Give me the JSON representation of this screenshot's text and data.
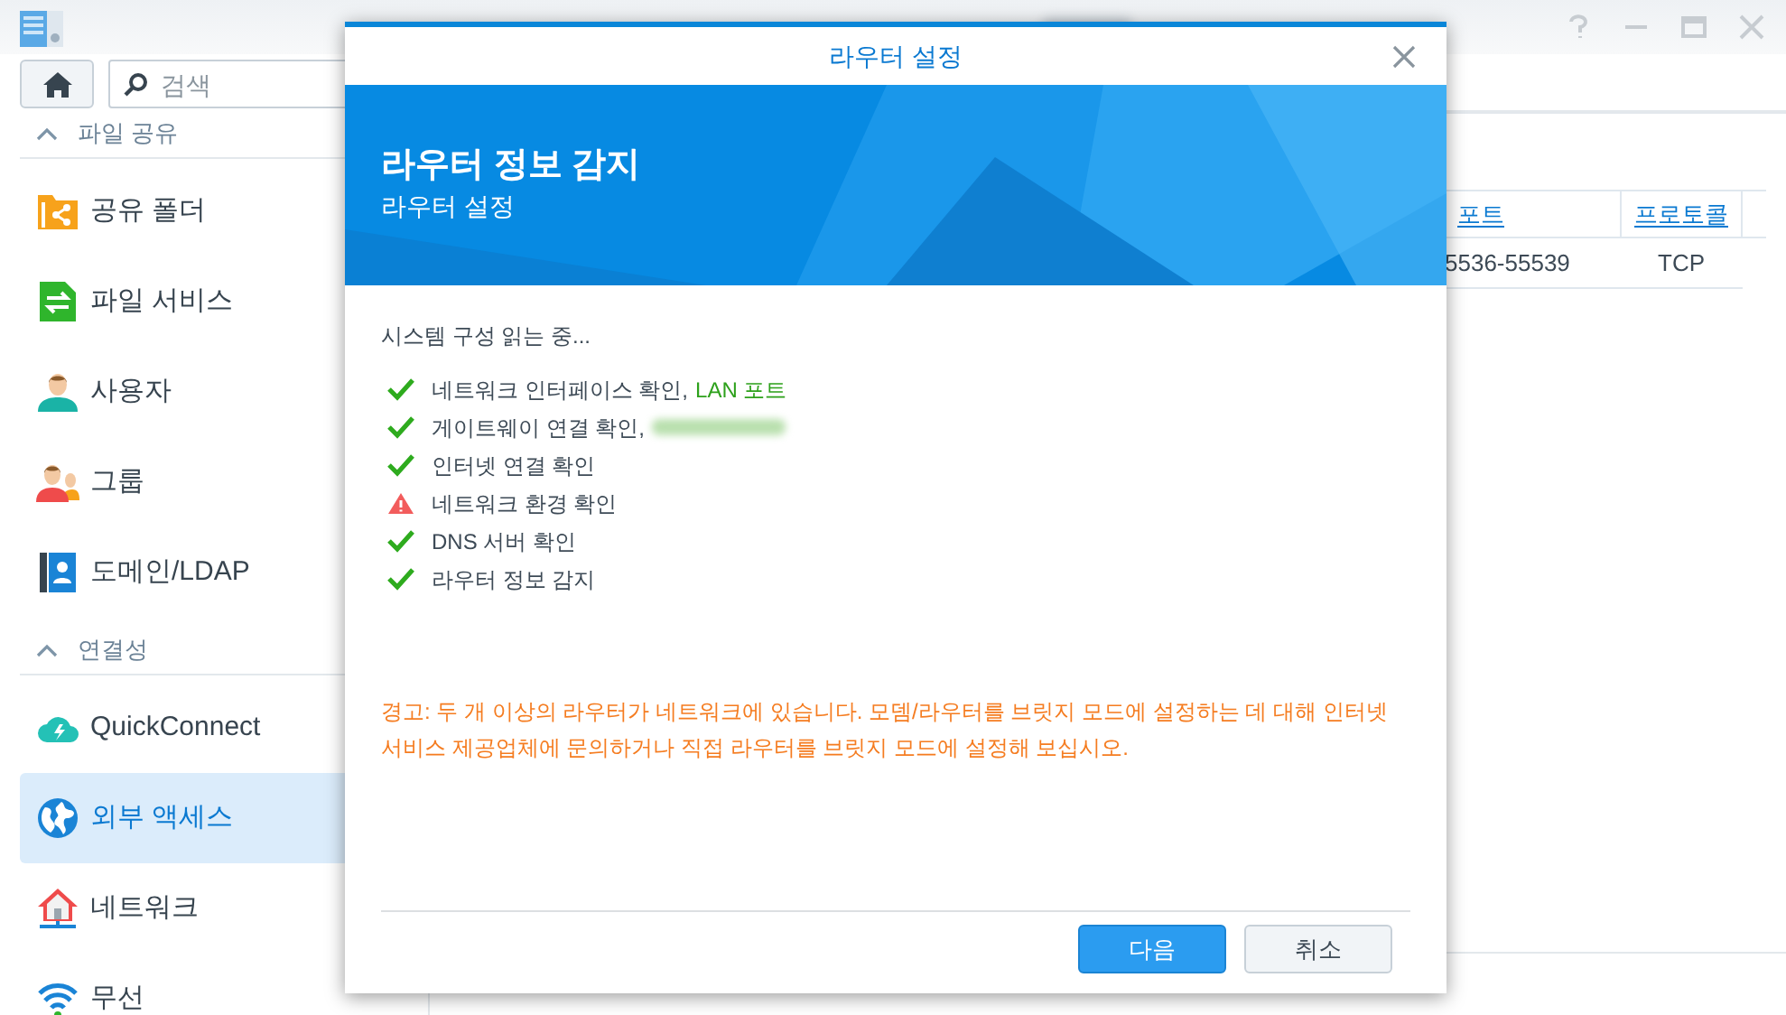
{
  "window": {
    "title_blurred": true
  },
  "toolbar": {
    "search": {
      "placeholder": "검색"
    }
  },
  "sidebar": {
    "sections": [
      {
        "title": "파일 공유",
        "expanded": true,
        "items": [
          {
            "label": "공유 폴더",
            "selected": false
          },
          {
            "label": "파일 서비스",
            "selected": false
          },
          {
            "label": "사용자",
            "selected": false
          },
          {
            "label": "그룹",
            "selected": false
          },
          {
            "label": "도메인/LDAP",
            "selected": false
          }
        ]
      },
      {
        "title": "연결성",
        "expanded": true,
        "items": [
          {
            "label": "QuickConnect",
            "selected": false
          },
          {
            "label": "외부 액세스",
            "selected": true
          },
          {
            "label": "네트워크",
            "selected": false
          },
          {
            "label": "무선",
            "selected": false
          }
        ]
      }
    ]
  },
  "table": {
    "columns": [
      "포트",
      "프로토콜"
    ],
    "rows": [
      [
        "5536-55539",
        "TCP"
      ]
    ]
  },
  "dialog": {
    "title": "라우터 설정",
    "banner_title": "라우터 정보 감지",
    "banner_subtitle": "라우터 설정",
    "status_line": "시스템 구성 읽는 중...",
    "checks": [
      {
        "kind": "ok",
        "text": "네트워크 인터페이스 확인,",
        "detail": "LAN 포트"
      },
      {
        "kind": "ok",
        "text": "게이트웨이 연결 확인,",
        "detail_blurred": true
      },
      {
        "kind": "ok",
        "text": "인터넷 연결 확인"
      },
      {
        "kind": "warning",
        "text": "네트워크 환경 확인"
      },
      {
        "kind": "ok",
        "text": "DNS 서버 확인"
      },
      {
        "kind": "ok",
        "text": "라우터 정보 감지"
      }
    ],
    "warning": "경고: 두 개 이상의 라우터가 네트워크에 있습니다. 모뎀/라우터를 브릿지 모드에 설정하는 데 대해 인터넷 서비스 제공업체에 문의하거나 직접 라우터를 브릿지 모드에 설정해 보십시오.",
    "buttons": [
      {
        "label": "다음",
        "kind": "primary"
      },
      {
        "label": "취소",
        "kind": "secondary"
      }
    ]
  }
}
